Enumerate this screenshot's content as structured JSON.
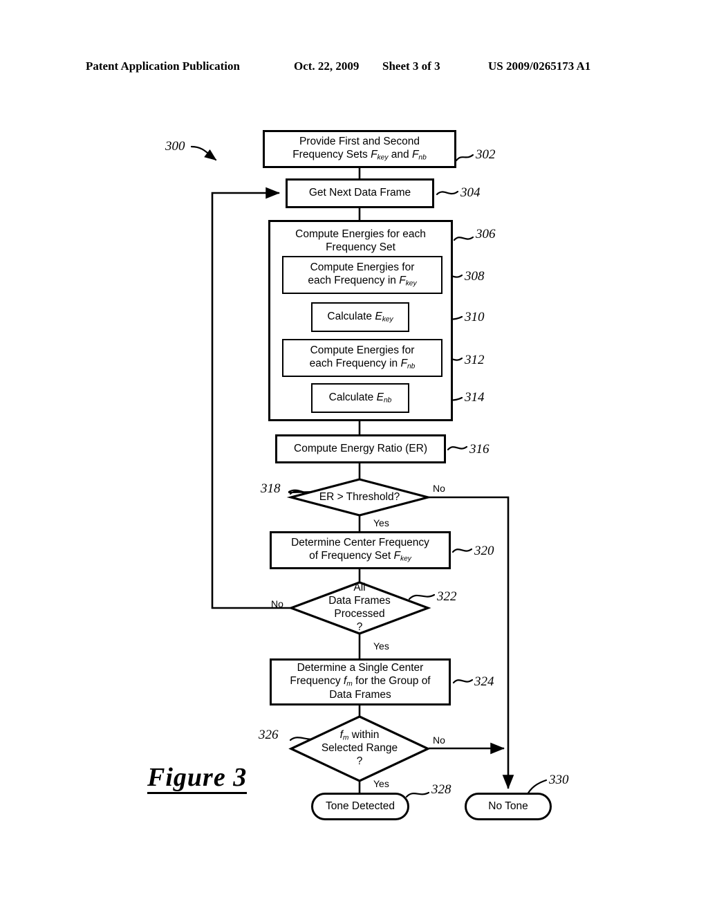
{
  "header": {
    "publication": "Patent Application Publication",
    "date": "Oct. 22, 2009",
    "sheet": "Sheet 3 of 3",
    "number": "US 2009/0265173 A1"
  },
  "figure": {
    "caption": "Figure 3",
    "diagram_ref": "300"
  },
  "nodes": {
    "n302": {
      "ref": "302",
      "line1": "Provide First and Second",
      "line2_a": "Frequency Sets ",
      "line2_f1": "F",
      "line2_f1sub": "key",
      "line2_b": " and ",
      "line2_f2": "F",
      "line2_f2sub": "nb"
    },
    "n304": {
      "ref": "304",
      "label": "Get Next Data Frame"
    },
    "n306": {
      "ref": "306",
      "line1": "Compute Energies for each",
      "line2": "Frequency Set"
    },
    "n308": {
      "ref": "308",
      "line1": "Compute Energies for",
      "line2_a": "each Frequency in  ",
      "line2_f": "F",
      "line2_fsub": "key"
    },
    "n310": {
      "ref": "310",
      "label_a": "Calculate ",
      "label_e": "E",
      "label_esub": "key"
    },
    "n312": {
      "ref": "312",
      "line1": "Compute Energies for",
      "line2_a": "each Frequency in  ",
      "line2_f": "F",
      "line2_fsub": "nb"
    },
    "n314": {
      "ref": "314",
      "label_a": "Calculate ",
      "label_e": "E",
      "label_esub": "nb"
    },
    "n316": {
      "ref": "316",
      "label": "Compute Energy Ratio (ER)"
    },
    "n318": {
      "ref": "318",
      "label": "ER > Threshold?",
      "yes": "Yes",
      "no": "No"
    },
    "n320": {
      "ref": "320",
      "line1": "Determine Center Frequency",
      "line2_a": "of Frequency Set ",
      "line2_f": "F",
      "line2_fsub": "key"
    },
    "n322": {
      "ref": "322",
      "line1": "All",
      "line2": "Data Frames",
      "line3": "Processed",
      "line4": "?",
      "yes": "Yes",
      "no": "No"
    },
    "n324": {
      "ref": "324",
      "line1": "Determine a Single Center",
      "line2_a": "Frequency ",
      "line2_f": "f",
      "line2_fsub": "m",
      "line2_b": " for the Group of",
      "line3": "Data Frames"
    },
    "n326": {
      "ref": "326",
      "line1_f": "f",
      "line1_fsub": "m",
      "line1_b": " within",
      "line2": "Selected Range",
      "line3": "?",
      "yes": "Yes",
      "no": "No"
    },
    "n328": {
      "ref": "328",
      "label": "Tone Detected"
    },
    "n330": {
      "ref": "330",
      "label": "No Tone"
    }
  }
}
